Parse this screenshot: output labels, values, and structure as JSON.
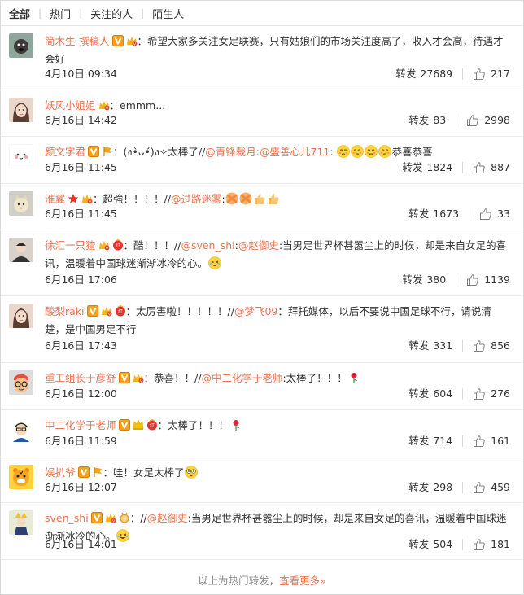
{
  "tabs": [
    "全部",
    "热门",
    "关注的人",
    "陌生人"
  ],
  "repost_label": "转发",
  "comments": [
    {
      "avatar_icon": "dog-avatar-icon",
      "user": "简木生-撰稿人",
      "badges": [
        "vip-v-icon",
        "fans-crown-icon"
      ],
      "text_parts": [
        {
          "t": "text",
          "v": "：希望大家多关注女足联赛，只有姑娘们的市场关注度高了，收入才会高，待遇才会好"
        }
      ],
      "time": "4月10日 09:34",
      "reposts": "27689",
      "likes": "217"
    },
    {
      "avatar_icon": "girl-avatar-icon",
      "user": "妖风小姐姐",
      "badges": [
        "fans-crown-icon"
      ],
      "text_parts": [
        {
          "t": "text",
          "v": "：emmm..."
        }
      ],
      "time": "6月16日 14:42",
      "reposts": "83",
      "likes": "2998"
    },
    {
      "avatar_icon": "cute-face-avatar-icon",
      "user": "颜文字君",
      "badges": [
        "vip-v-icon",
        "flag-icon"
      ],
      "text_parts": [
        {
          "t": "text",
          "v": "：(ง•̀ᴗ•́)ง✧太棒了//"
        },
        {
          "t": "at",
          "v": "@青锋裁月"
        },
        {
          "t": "text",
          "v": ":"
        },
        {
          "t": "at",
          "v": "@盛善心儿711"
        },
        {
          "t": "text",
          "v": ": "
        },
        {
          "t": "emoji",
          "v": "shy-emoji"
        },
        {
          "t": "emoji",
          "v": "shy-emoji"
        },
        {
          "t": "emoji",
          "v": "shy-emoji"
        },
        {
          "t": "emoji",
          "v": "shy-emoji"
        },
        {
          "t": "text",
          "v": "恭喜恭喜"
        }
      ],
      "time": "6月16日 11:45",
      "reposts": "1824",
      "likes": "887"
    },
    {
      "avatar_icon": "cat-avatar-icon",
      "user": "淮翼",
      "badges": [
        "star-icon",
        "fans-crown-icon"
      ],
      "text_parts": [
        {
          "t": "text",
          "v": "：超強！！！！//"
        },
        {
          "t": "at",
          "v": "@过路迷雾"
        },
        {
          "t": "text",
          "v": ":"
        },
        {
          "t": "emoji",
          "v": "cross-emoji"
        },
        {
          "t": "emoji",
          "v": "cross-emoji"
        },
        {
          "t": "emoji",
          "v": "thumbsup-emoji"
        },
        {
          "t": "emoji",
          "v": "thumbsup-emoji"
        }
      ],
      "time": "6月16日 11:45",
      "reposts": "1673",
      "likes": "33"
    },
    {
      "avatar_icon": "person-avatar-icon",
      "user": "徐汇一只猹",
      "badges": [
        "fans-crown-icon",
        "red-badge-icon"
      ],
      "text_parts": [
        {
          "t": "text",
          "v": "：酷！！！//"
        },
        {
          "t": "at",
          "v": "@sven_shi"
        },
        {
          "t": "text",
          "v": ":"
        },
        {
          "t": "at",
          "v": "@赵御史"
        },
        {
          "t": "text",
          "v": ":当男足世界杯甚嚣尘上的时候，却是来自女足的喜讯，温暖着中国球迷渐渐冰冷的心。"
        },
        {
          "t": "emoji",
          "v": "laugh-emoji"
        }
      ],
      "time": "6月16日 17:06",
      "reposts": "380",
      "likes": "1139"
    },
    {
      "avatar_icon": "girl-avatar-icon",
      "user": "酸梨raki",
      "badges": [
        "vip-v-icon",
        "fans-crown-icon",
        "red-badge-icon"
      ],
      "text_parts": [
        {
          "t": "text",
          "v": "：太厉害啦！！！！！//"
        },
        {
          "t": "at",
          "v": "@梦飞09"
        },
        {
          "t": "text",
          "v": "：拜托媒体，以后不要说中国足球不行，请说清楚，是中国男足不行"
        }
      ],
      "time": "6月16日 17:43",
      "reposts": "331",
      "likes": "856"
    },
    {
      "avatar_icon": "glasses-avatar-icon",
      "user": "重工组长于彦舒",
      "badges": [
        "vip-v-icon",
        "fans-crown-icon"
      ],
      "text_parts": [
        {
          "t": "text",
          "v": "：恭喜！！//"
        },
        {
          "t": "at",
          "v": "@中二化学于老师"
        },
        {
          "t": "text",
          "v": ":太棒了！！！"
        },
        {
          "t": "emoji",
          "v": "rose-emoji"
        }
      ],
      "time": "6月16日 12:00",
      "reposts": "604",
      "likes": "276"
    },
    {
      "avatar_icon": "teacher-avatar-icon",
      "user": "中二化学于老师",
      "badges": [
        "vip-v-icon",
        "gold-crown-icon",
        "red-badge-icon"
      ],
      "text_parts": [
        {
          "t": "text",
          "v": "：太棒了！！！"
        },
        {
          "t": "emoji",
          "v": "rose-emoji"
        }
      ],
      "time": "6月16日 11:59",
      "reposts": "714",
      "likes": "161"
    },
    {
      "avatar_icon": "tiger-avatar-icon",
      "user": "娱扒爷",
      "badges": [
        "vip-v-icon",
        "flag-icon"
      ],
      "text_parts": [
        {
          "t": "text",
          "v": "：哇！女足太棒了"
        },
        {
          "t": "emoji",
          "v": "wow-emoji"
        }
      ],
      "time": "6月16日 12:07",
      "reposts": "298",
      "likes": "459"
    },
    {
      "avatar_icon": "figure-avatar-icon",
      "user": "sven_shi",
      "badges": [
        "vip-v-icon",
        "fans-crown-icon",
        "medal-icon"
      ],
      "text_parts": [
        {
          "t": "text",
          "v": "：//"
        },
        {
          "t": "at",
          "v": "@赵御史"
        },
        {
          "t": "text",
          "v": ":当男足世界杯甚嚣尘上的时候，却是来自女足的喜讯，温暖着中国球迷渐渐冰冷的心。"
        },
        {
          "t": "emoji",
          "v": "laugh-emoji"
        }
      ],
      "time": "6月16日 14:01",
      "reposts": "504",
      "likes": "181"
    }
  ],
  "footer": {
    "prefix": "以上为热门转发，",
    "more": "查看更多»"
  }
}
